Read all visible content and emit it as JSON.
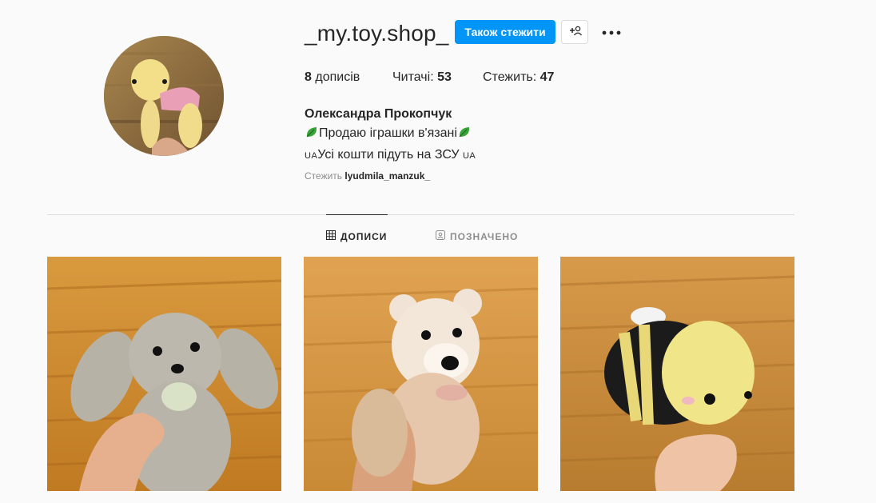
{
  "profile": {
    "username": "_my.toy.shop_",
    "follow_button": "Також стежити",
    "stats": [
      {
        "value": "8",
        "label": " дописів"
      },
      {
        "label": "Читачі: ",
        "value": "53"
      },
      {
        "label": "Стежить: ",
        "value": "47"
      }
    ],
    "full_name": "Олександра Прокопчук",
    "bio_line1": "Продаю іграшки в'язані",
    "bio_line2_flag1": "UA",
    "bio_line2_text": "Усі кошти підуть на ЗСУ ",
    "bio_line2_flag2": "UA",
    "followed_by_prefix": "Стежить ",
    "followed_by_user": "lyudmila_manzuk_"
  },
  "tabs": [
    {
      "label": "ДОПИСИ",
      "icon": "grid-icon",
      "active": true
    },
    {
      "label": "ПОЗНАЧЕНО",
      "icon": "tagged-icon",
      "active": false
    }
  ],
  "posts": [
    {
      "subject": "grey bunny toy"
    },
    {
      "subject": "beige bear toy"
    },
    {
      "subject": "yellow bee toy"
    }
  ],
  "colors": {
    "accent": "#0095f6",
    "text": "#262626",
    "muted": "#8e8e8e",
    "border": "#dbdbdb",
    "background": "#fafafa"
  }
}
